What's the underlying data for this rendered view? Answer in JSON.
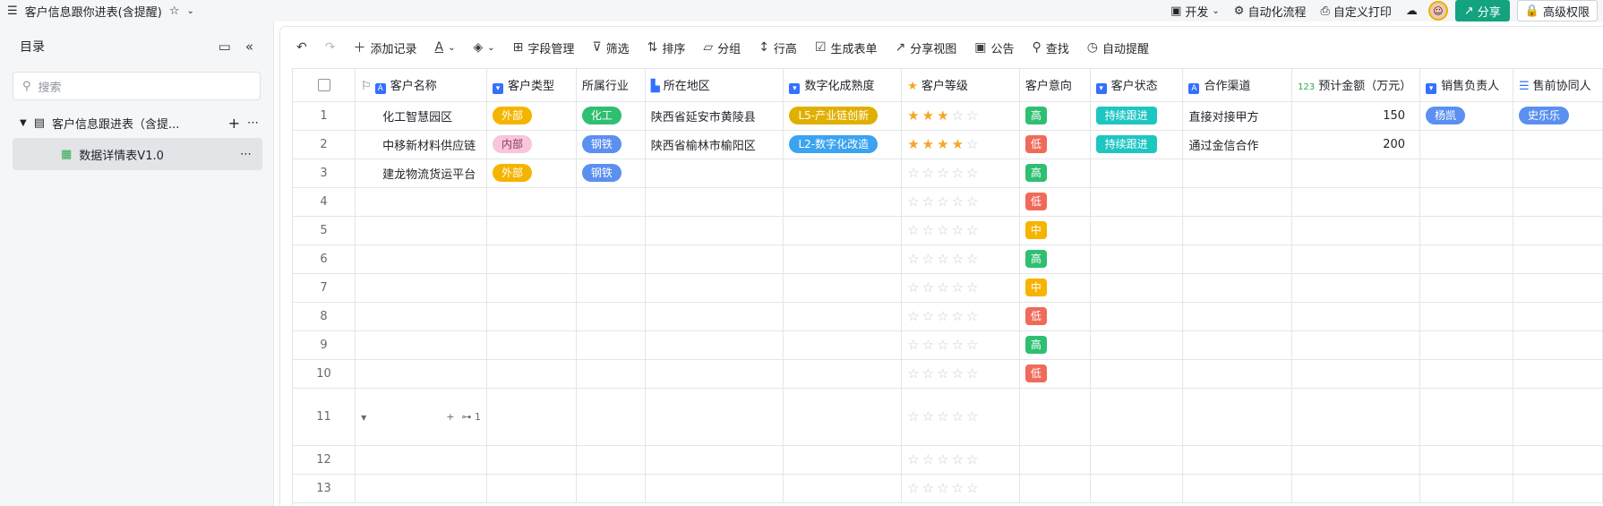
{
  "topbar": {
    "title": "客户信息跟你进表(含提醒)",
    "dev": "开发",
    "automation": "自动化流程",
    "print": "自定义打印",
    "share": "分享",
    "permission": "高级权限"
  },
  "sidebar": {
    "title": "目录",
    "search_placeholder": "搜索",
    "table_name": "客户信息跟进表（含提...",
    "view_name": "数据详情表V1.0"
  },
  "toolbar": {
    "add": "添加记录",
    "fields": "字段管理",
    "filter": "筛选",
    "sort": "排序",
    "group": "分组",
    "rowheight": "行高",
    "form": "生成表单",
    "shareview": "分享视图",
    "notice": "公告",
    "find": "查找",
    "remind": "自动提醒"
  },
  "columns": {
    "name": "客户名称",
    "type": "客户类型",
    "industry": "所属行业",
    "region": "所在地区",
    "digital": "数字化成熟度",
    "level": "客户等级",
    "intent": "客户意向",
    "status": "客户状态",
    "channel": "合作渠道",
    "amount": "预计金额（万元）",
    "sales": "销售负责人",
    "presales": "售前协同人"
  },
  "rows": [
    {
      "n": "1",
      "name": "化工智慧园区",
      "type": "外部",
      "industry": "化工",
      "region": "陕西省延安市黄陵县",
      "digital": "L5-产业链创新",
      "stars": 3,
      "intent": "高",
      "status": "持续跟进",
      "channel": "直接对接甲方",
      "amount": "150",
      "sales": "杨凯",
      "presales": "史乐乐"
    },
    {
      "n": "2",
      "name": "中移新材料供应链",
      "type": "内部",
      "industry": "钢铁",
      "region": "陕西省榆林市榆阳区",
      "digital": "L2-数字化改造",
      "stars": 4,
      "intent": "低",
      "status": "持续跟进",
      "channel": "通过金信合作",
      "amount": "200",
      "sales": "",
      "presales": ""
    },
    {
      "n": "3",
      "name": "建龙物流货运平台",
      "type": "外部",
      "industry": "钢铁",
      "region": "",
      "digital": "",
      "stars": 0,
      "intent": "高",
      "status": "",
      "channel": "",
      "amount": "",
      "sales": "",
      "presales": ""
    },
    {
      "n": "4",
      "intent": "低",
      "stars": 0
    },
    {
      "n": "5",
      "intent": "中",
      "stars": 0
    },
    {
      "n": "6",
      "intent": "高",
      "stars": 0
    },
    {
      "n": "7",
      "intent": "中",
      "stars": 0
    },
    {
      "n": "8",
      "intent": "低",
      "stars": 0
    },
    {
      "n": "9",
      "intent": "高",
      "stars": 0
    },
    {
      "n": "10",
      "intent": "低",
      "stars": 0
    },
    {
      "n": "11",
      "intent": "",
      "stars": 0,
      "subcount": "1"
    },
    {
      "n": "12",
      "intent": "",
      "stars": 0
    },
    {
      "n": "13",
      "intent": "",
      "stars": 0
    }
  ],
  "colors": {
    "外部": "#f5b400",
    "内部": "#f7c5dc",
    "化工": "#2fbf71",
    "钢铁": "#5b8ff0",
    "L5-产业链创新": "#e0b000",
    "L2-数字化改造": "#3ba3f0",
    "高": "#2fbf71",
    "低": "#f06a5a",
    "中": "#f5b400",
    "持续跟进": "#1ec6c2",
    "杨凯": "#5b8ff0",
    "史乐乐": "#5b8ff0"
  }
}
